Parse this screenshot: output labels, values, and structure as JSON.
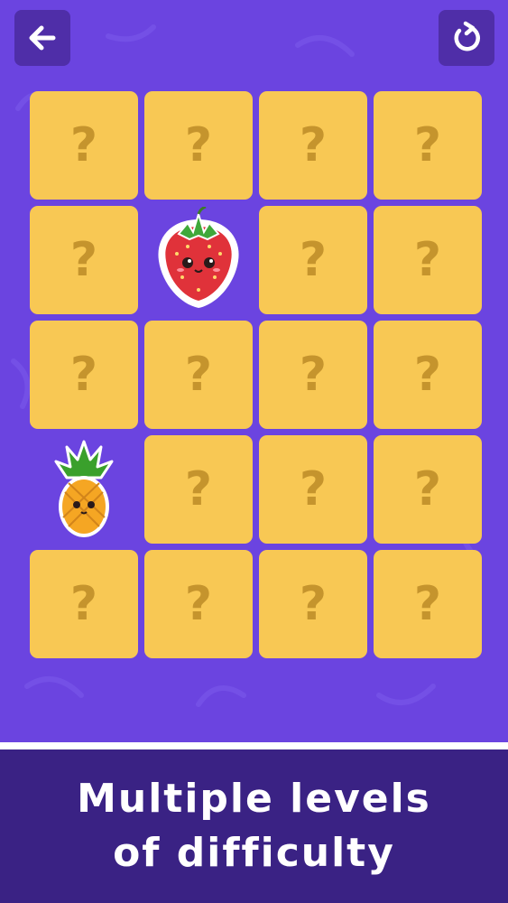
{
  "toolbar": {
    "back_icon": "arrow-left-icon",
    "restart_icon": "restart-icon"
  },
  "board": {
    "rows": 5,
    "cols": 4,
    "hidden_symbol": "?",
    "revealed": [
      {
        "row": 2,
        "col": 2,
        "fruit": "strawberry"
      },
      {
        "row": 4,
        "col": 1,
        "fruit": "pineapple"
      }
    ],
    "empty": []
  },
  "banner": {
    "line1": "Multiple levels",
    "line2": "of difficulty"
  },
  "colors": {
    "background": "#6b44e0",
    "card": "#f8c854",
    "question_mark": "#c5942d",
    "button": "#4f2ea8",
    "banner": "#3a2284",
    "text": "#ffffff"
  }
}
